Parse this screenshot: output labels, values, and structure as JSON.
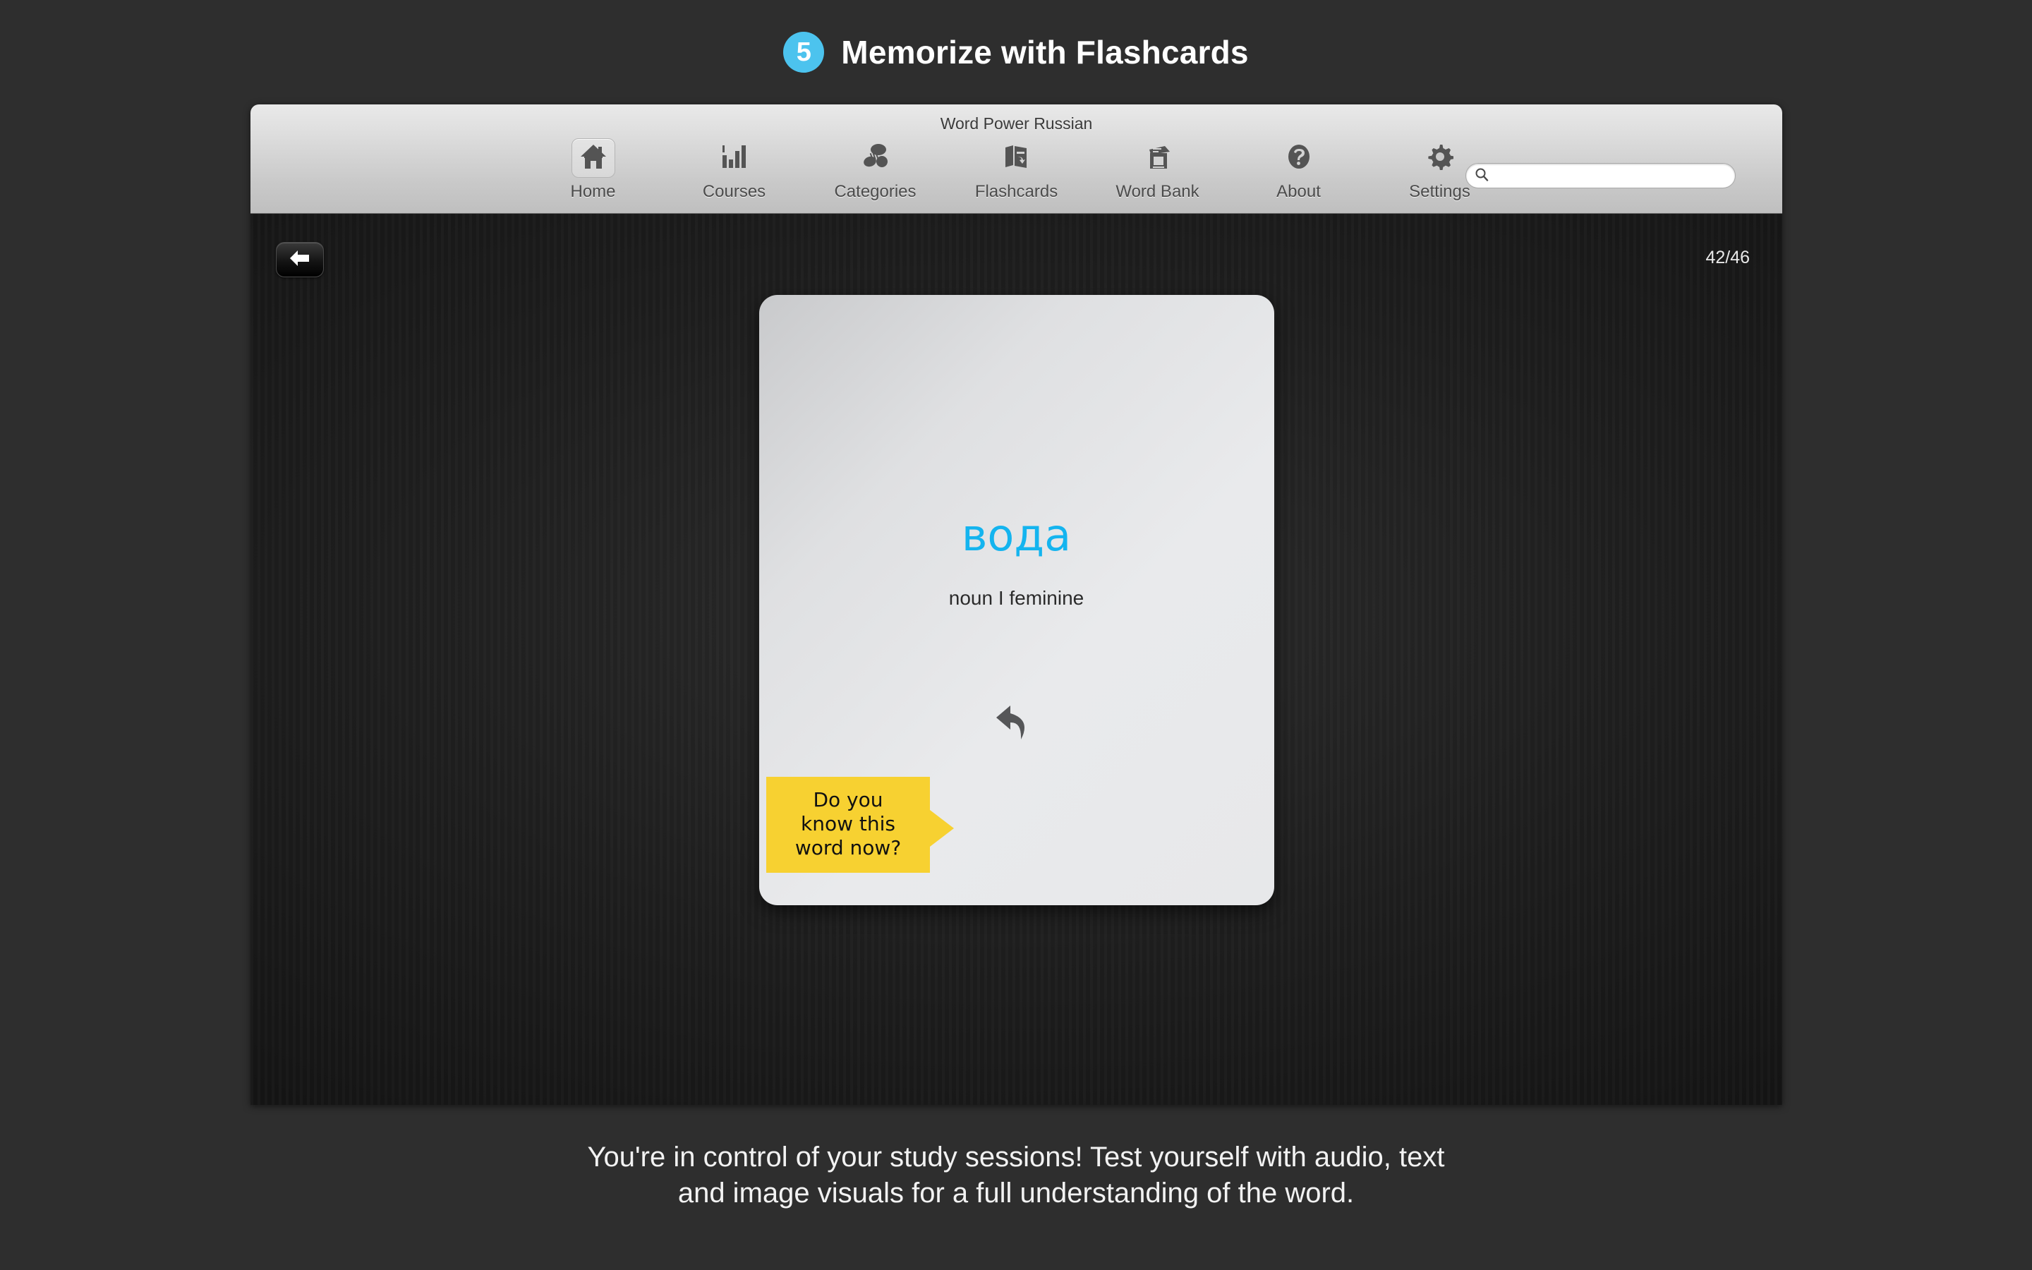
{
  "header": {
    "step_number": "5",
    "title": "Memorize with Flashcards",
    "badge_color": "#4cc3ee"
  },
  "window": {
    "title": "Word Power Russian"
  },
  "toolbar": {
    "items": [
      {
        "label": "Home",
        "icon": "home-icon",
        "selected": true
      },
      {
        "label": "Courses",
        "icon": "bar-chart-icon",
        "selected": false
      },
      {
        "label": "Categories",
        "icon": "categories-icon",
        "selected": false
      },
      {
        "label": "Flashcards",
        "icon": "flashcards-icon",
        "selected": false
      },
      {
        "label": "Word Bank",
        "icon": "word-bank-icon",
        "selected": false
      },
      {
        "label": "About",
        "icon": "question-mark-icon",
        "selected": false
      },
      {
        "label": "Settings",
        "icon": "gear-icon",
        "selected": false
      }
    ],
    "search": {
      "icon": "search-icon",
      "value": "",
      "placeholder": ""
    }
  },
  "content": {
    "back_button_icon": "left-arrow-icon",
    "counter": "42/46",
    "flashcard": {
      "word": "вода",
      "word_color": "#14b4ef",
      "part_of_speech": "noun I feminine",
      "flip_icon": "flip-back-arrow-icon"
    },
    "callout": {
      "line1": "Do you",
      "line2": "know this",
      "line3": "word now?",
      "background_color": "#f7d131"
    }
  },
  "caption": {
    "line1": "You're in control of your study sessions! Test yourself with audio, text",
    "line2": "and image visuals for a full understanding of the word."
  }
}
